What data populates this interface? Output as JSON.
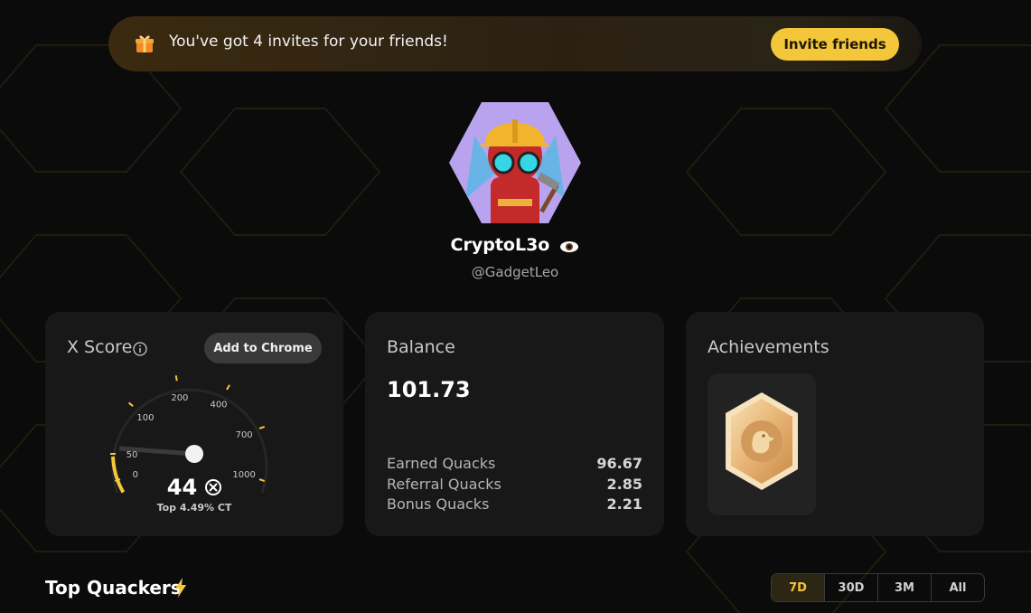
{
  "banner": {
    "text": "You've got 4 invites for your friends!",
    "button_label": "Invite friends",
    "icon": "gift-icon"
  },
  "profile": {
    "display_name": "CryptoL3o",
    "handle": "@GadgetLeo",
    "verified_icon": "eye-icon"
  },
  "xscore": {
    "title": "X Score",
    "add_to_chrome": "Add to Chrome",
    "score": "44",
    "rank": "Top 4.49% CT",
    "gauge_ticks": [
      "0",
      "50",
      "100",
      "200",
      "400",
      "700",
      "1000"
    ],
    "gauge_value": 44,
    "accent": "#f4c63a"
  },
  "balance": {
    "title": "Balance",
    "value": "101.73",
    "rows": [
      {
        "label": "Earned Quacks",
        "value": "96.67"
      },
      {
        "label": "Referral Quacks",
        "value": "2.85"
      },
      {
        "label": "Bonus Quacks",
        "value": "2.21"
      }
    ]
  },
  "achievements": {
    "title": "Achievements",
    "badge": "duck-badge-icon"
  },
  "leaderboard": {
    "title": "Top Quackers",
    "tabs": [
      "7D",
      "30D",
      "3M",
      "All"
    ],
    "active_tab": "7D"
  },
  "colors": {
    "background": "#0b0b0b",
    "card": "#181818",
    "accent": "#f4c63a"
  }
}
